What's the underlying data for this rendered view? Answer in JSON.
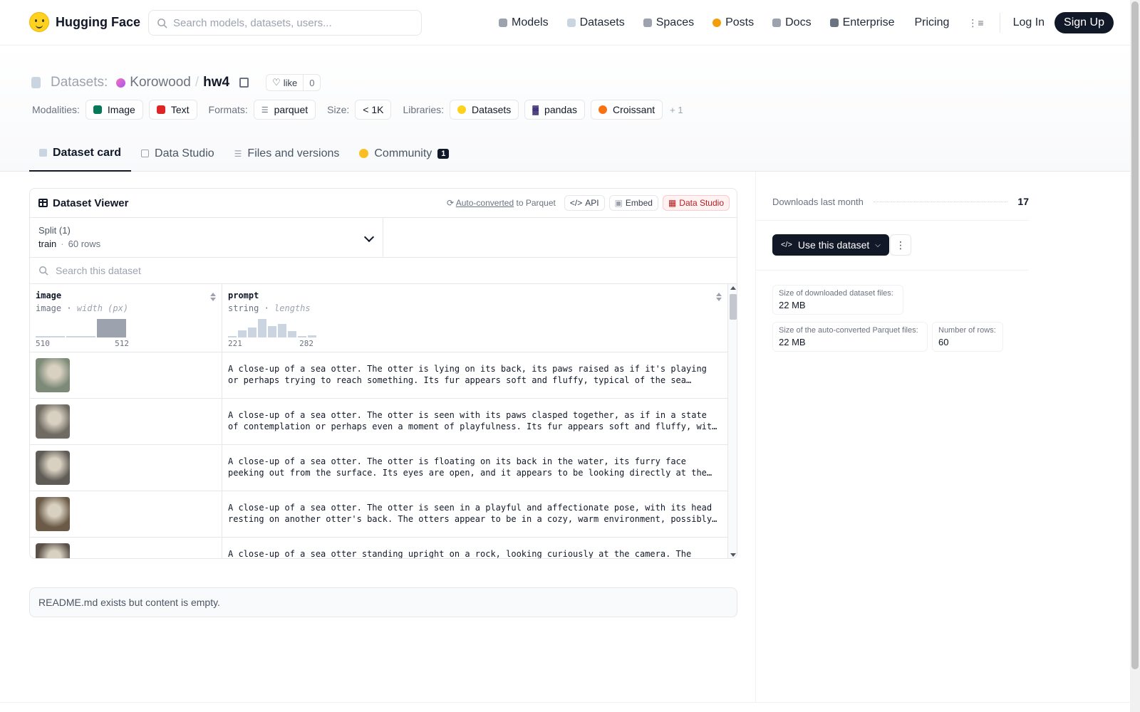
{
  "nav": {
    "brand": "Hugging Face",
    "search_placeholder": "Search models, datasets, users...",
    "links": [
      {
        "label": "Models",
        "icon": "cube-icon",
        "color": "#9ca3af"
      },
      {
        "label": "Datasets",
        "icon": "database-icon",
        "color": "#cbd5e1"
      },
      {
        "label": "Spaces",
        "icon": "grid-icon",
        "color": "#9ca3af"
      },
      {
        "label": "Posts",
        "icon": "speech-bubble-icon",
        "color": "#f59e0b"
      },
      {
        "label": "Docs",
        "icon": "book-icon",
        "color": "#9ca3af"
      },
      {
        "label": "Enterprise",
        "icon": "building-icon",
        "color": "#6b7280"
      },
      {
        "label": "Pricing",
        "icon": "",
        "color": ""
      }
    ],
    "login": "Log In",
    "signup": "Sign Up"
  },
  "header": {
    "section_label": "Datasets:",
    "org": "Korowood",
    "repo": "hw4",
    "like_label": "like",
    "like_count": "0",
    "modalities_label": "Modalities:",
    "modalities": [
      {
        "label": "Image",
        "color": "#047857"
      },
      {
        "label": "Text",
        "color": "#dc2626"
      }
    ],
    "formats_label": "Formats:",
    "formats": [
      "parquet"
    ],
    "size_label": "Size:",
    "size": "< 1K",
    "libraries_label": "Libraries:",
    "libraries": [
      "Datasets",
      "pandas",
      "Croissant"
    ],
    "libraries_more": "+ 1"
  },
  "tabs": [
    {
      "label": "Dataset card",
      "active": true
    },
    {
      "label": "Data Studio",
      "active": false
    },
    {
      "label": "Files and versions",
      "active": false
    },
    {
      "label": "Community",
      "active": false,
      "badge": "1"
    }
  ],
  "viewer": {
    "title": "Dataset Viewer",
    "auto_converted": "Auto-converted",
    "to_parquet": "to Parquet",
    "api": "API",
    "embed": "Embed",
    "data_studio": "Data Studio",
    "split_label": "Split (1)",
    "split_name": "train",
    "split_rows": "60 rows",
    "search_placeholder": "Search this dataset",
    "columns": [
      {
        "name": "image",
        "type": "image",
        "stat": "width (px)",
        "min": "510",
        "max": "512",
        "hist": [
          0.05,
          0.05,
          1.0
        ]
      },
      {
        "name": "prompt",
        "type": "string",
        "stat": "lengths",
        "min": "221",
        "max": "282",
        "hist": [
          0.05,
          0.38,
          0.55,
          1.0,
          0.6,
          0.72,
          0.35,
          0.05,
          0.12
        ]
      }
    ],
    "rows": [
      {
        "thumb_color": "#7d8a78",
        "prompt": "A close-up of a sea otter. The otter is lying on its back, its paws raised as if it's playing or perhaps trying to reach something. Its fur appears soft and fluffy, typical of the sea otter's dense coat."
      },
      {
        "thumb_color": "#6f6a62",
        "prompt": "A close-up of a sea otter. The otter is seen with its paws clasped together, as if in a state of contemplation or perhaps even a moment of playfulness. Its fur appears soft and fluffy, with a mix of brown tones."
      },
      {
        "thumb_color": "#5f5b55",
        "prompt": "A close-up of a sea otter. The otter is floating on its back in the water, its furry face peeking out from the surface. Its eyes are open, and it appears to be looking directly at the camera with curiosity."
      },
      {
        "thumb_color": "#6b5a47",
        "prompt": "A close-up of a sea otter. The otter is seen in a playful and affectionate pose, with its head resting on another otter's back. The otters appear to be in a cozy, warm environment, possibly a den."
      },
      {
        "thumb_color": "#5a5048",
        "prompt": "A close-up of a sea otter standing upright on a rock, looking curiously at the camera. The otter's"
      }
    ]
  },
  "readme_text": "README.md exists but content is empty.",
  "sidebar": {
    "downloads_label": "Downloads last month",
    "downloads_value": "17",
    "use_dataset": "Use this dataset",
    "stats": [
      {
        "label": "Size of downloaded dataset files:",
        "value": "22 MB"
      },
      {
        "label": "Size of the auto-converted Parquet files:",
        "value": "22 MB"
      },
      {
        "label": "Number of rows:",
        "value": "60"
      }
    ]
  }
}
